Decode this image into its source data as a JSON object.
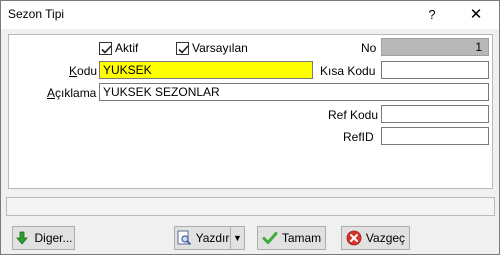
{
  "window": {
    "title": "Sezon Tipi",
    "help_glyph": "?",
    "close_glyph": "✕"
  },
  "form": {
    "aktif": {
      "label": "Aktif",
      "checked": true
    },
    "varsayilan": {
      "label": "Varsayılan",
      "checked": true
    },
    "no": {
      "label": "No",
      "value": "1"
    },
    "kodu": {
      "label": "Kodu",
      "value": "YUKSEK"
    },
    "kisa_kodu": {
      "label": "Kısa Kodu",
      "value": ""
    },
    "aciklama": {
      "label": "Açıklama",
      "value": "YUKSEK SEZONLAR"
    },
    "ref_kodu": {
      "label": "Ref Kodu",
      "value": ""
    },
    "ref_id": {
      "label": "RefID",
      "value": ""
    }
  },
  "buttons": {
    "diger": {
      "label": "Diger...",
      "icon": "down-arrow-icon",
      "color": "#2e9e2e"
    },
    "yazdir": {
      "label": "Yazdır",
      "icon": "print-preview-icon"
    },
    "tamam": {
      "label": "Tamam",
      "icon": "checkmark-icon",
      "color": "#3cab3c"
    },
    "vazgec": {
      "label": "Vazgeç",
      "icon": "cancel-icon",
      "color": "#d9312b"
    }
  },
  "statusbar": {
    "text": ""
  }
}
